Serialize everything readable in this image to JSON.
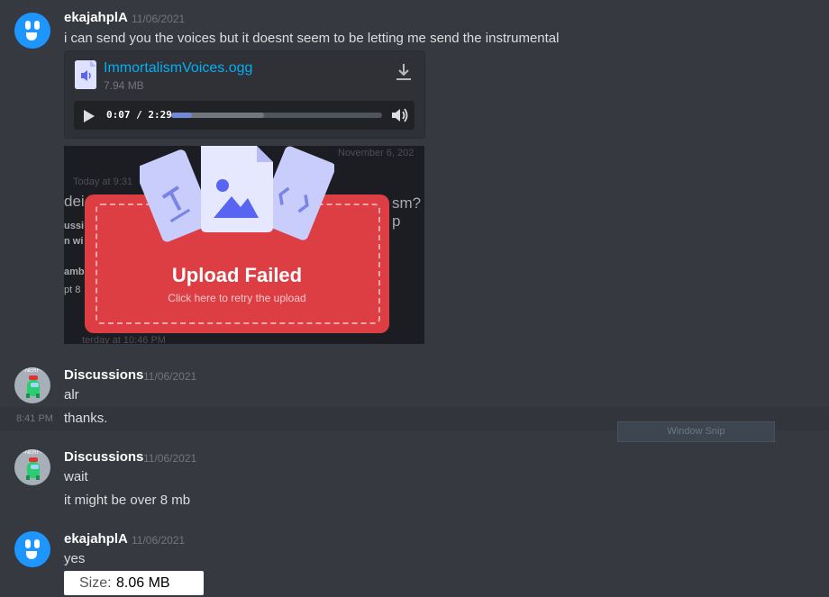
{
  "messages": [
    {
      "username": "ekajahplA",
      "timestamp": "11/06/2021",
      "text": "i can send you the voices but it doesnt seem to be letting me send the instrumental",
      "attachment": {
        "filename": "ImmortalismVoices.ogg",
        "filesize": "7.94 MB",
        "time": "0:07 / 2:29",
        "progress": 0.047,
        "buffered": 0.44
      }
    },
    {
      "username": "Discussions",
      "timestamp": "11/06/2021",
      "text": "alr",
      "avatar_text": "-NERF-"
    },
    {
      "hover_time": "8:41 PM",
      "text": "thanks."
    },
    {
      "username": "Discussions",
      "timestamp": "11/06/2021",
      "text": "wait",
      "avatar_text": "-NERF-"
    },
    {
      "text": "it might be over 8 mb"
    },
    {
      "username": "ekajahplA",
      "timestamp": "11/06/2021",
      "text": "yes"
    }
  ],
  "upload_image": {
    "title": "Upload Failed",
    "subtitle": "Click here to retry the upload",
    "bg_date": "November 6, 202",
    "bg_today": "Today at 9:31",
    "bg_question": "sm? p",
    "bg_yesterday": "terday at 10:46 PM",
    "bg_letters": [
      "dei",
      "ussi",
      "n wi",
      "amb",
      "pt 8"
    ]
  },
  "size_popup": {
    "label": "Size:",
    "value": "8.06 MB"
  },
  "window_snip": "Window Snip",
  "colors": {
    "background": "#36393f",
    "link": "#00b0f4",
    "upload_red": "#dc3e44",
    "blurple": "#7289da"
  }
}
